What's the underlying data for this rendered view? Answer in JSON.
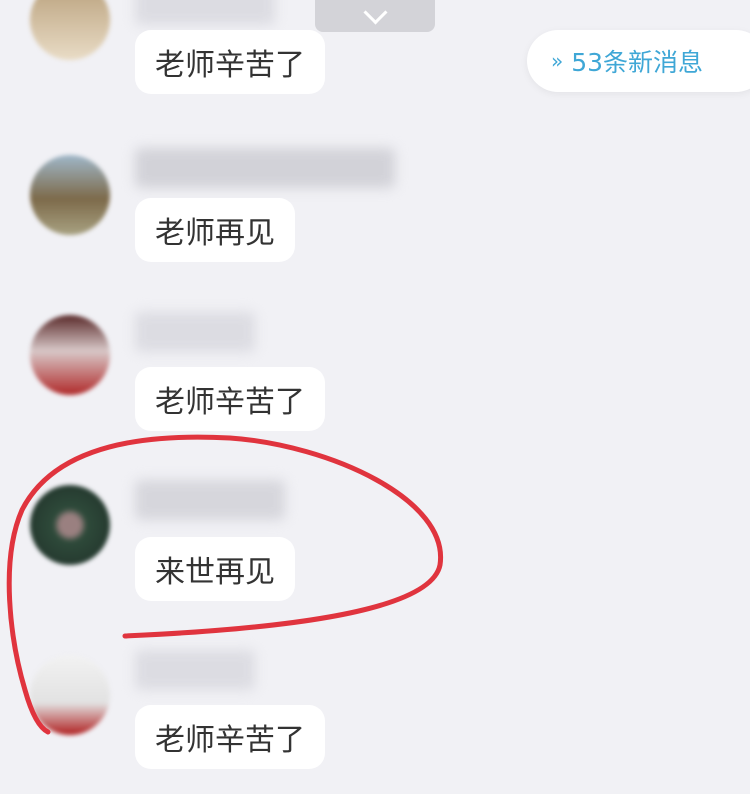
{
  "scroll_button": {
    "icon": "chevron-down-icon"
  },
  "new_messages": {
    "icon": "double-chevron-up-icon",
    "label": "53条新消息",
    "color": "#3fa7d6"
  },
  "messages": [
    {
      "text": "老师辛苦了",
      "avatar_colors": [
        "#c9b08a",
        "#e8d8c0"
      ]
    },
    {
      "text": "老师再见",
      "avatar_colors": [
        "#6a7f8f",
        "#a89a6a"
      ]
    },
    {
      "text": "老师辛苦了",
      "avatar_colors": [
        "#8a2a2a",
        "#d9c6c6"
      ]
    },
    {
      "text": "来世再见",
      "avatar_colors": [
        "#2f4a3a",
        "#9a8a8a"
      ]
    },
    {
      "text": "老师辛苦了",
      "avatar_colors": [
        "#b02020",
        "#f2f2f2"
      ]
    }
  ],
  "annotation_color": "#e0343e"
}
